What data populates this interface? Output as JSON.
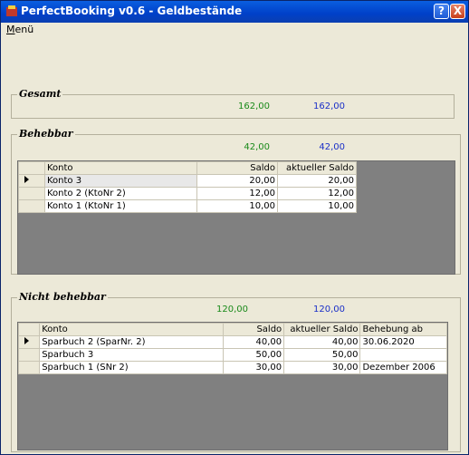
{
  "window": {
    "title": "PerfectBooking v0.6 - Geldbestände",
    "help_btn": "?",
    "close_btn": "X"
  },
  "menu": {
    "first_letter": "M",
    "rest": "enü"
  },
  "gesamt": {
    "title": "Gesamt",
    "saldo": "162,00",
    "aktueller_saldo": "162,00"
  },
  "behebbar": {
    "title": "Behebbar",
    "saldo": "42,00",
    "aktueller_saldo": "42,00",
    "columns": [
      "Konto",
      "Saldo",
      "aktueller Saldo"
    ],
    "rows": [
      {
        "konto": "Konto 3",
        "saldo": "20,00",
        "aktuell": "20,00"
      },
      {
        "konto": "Konto 2 (KtoNr 2)",
        "saldo": "12,00",
        "aktuell": "12,00"
      },
      {
        "konto": "Konto 1 (KtoNr 1)",
        "saldo": "10,00",
        "aktuell": "10,00"
      }
    ]
  },
  "nicht_behebbar": {
    "title": "Nicht behebbar",
    "saldo": "120,00",
    "aktueller_saldo": "120,00",
    "columns": [
      "Konto",
      "Saldo",
      "aktueller Saldo",
      "Behebung ab"
    ],
    "rows": [
      {
        "konto": "Sparbuch 2 (SparNr. 2)",
        "saldo": "40,00",
        "aktuell": "40,00",
        "behebung": "30.06.2020"
      },
      {
        "konto": "Sparbuch 3",
        "saldo": "50,00",
        "aktuell": "50,00",
        "behebung": ""
      },
      {
        "konto": "Sparbuch 1 (SNr 2)",
        "saldo": "30,00",
        "aktuell": "30,00",
        "behebung": "Dezember 2006"
      }
    ]
  },
  "colors": {
    "saldo": "#1a8a1a",
    "aktueller_saldo": "#1a2fc8",
    "grid_background": "#808080"
  }
}
